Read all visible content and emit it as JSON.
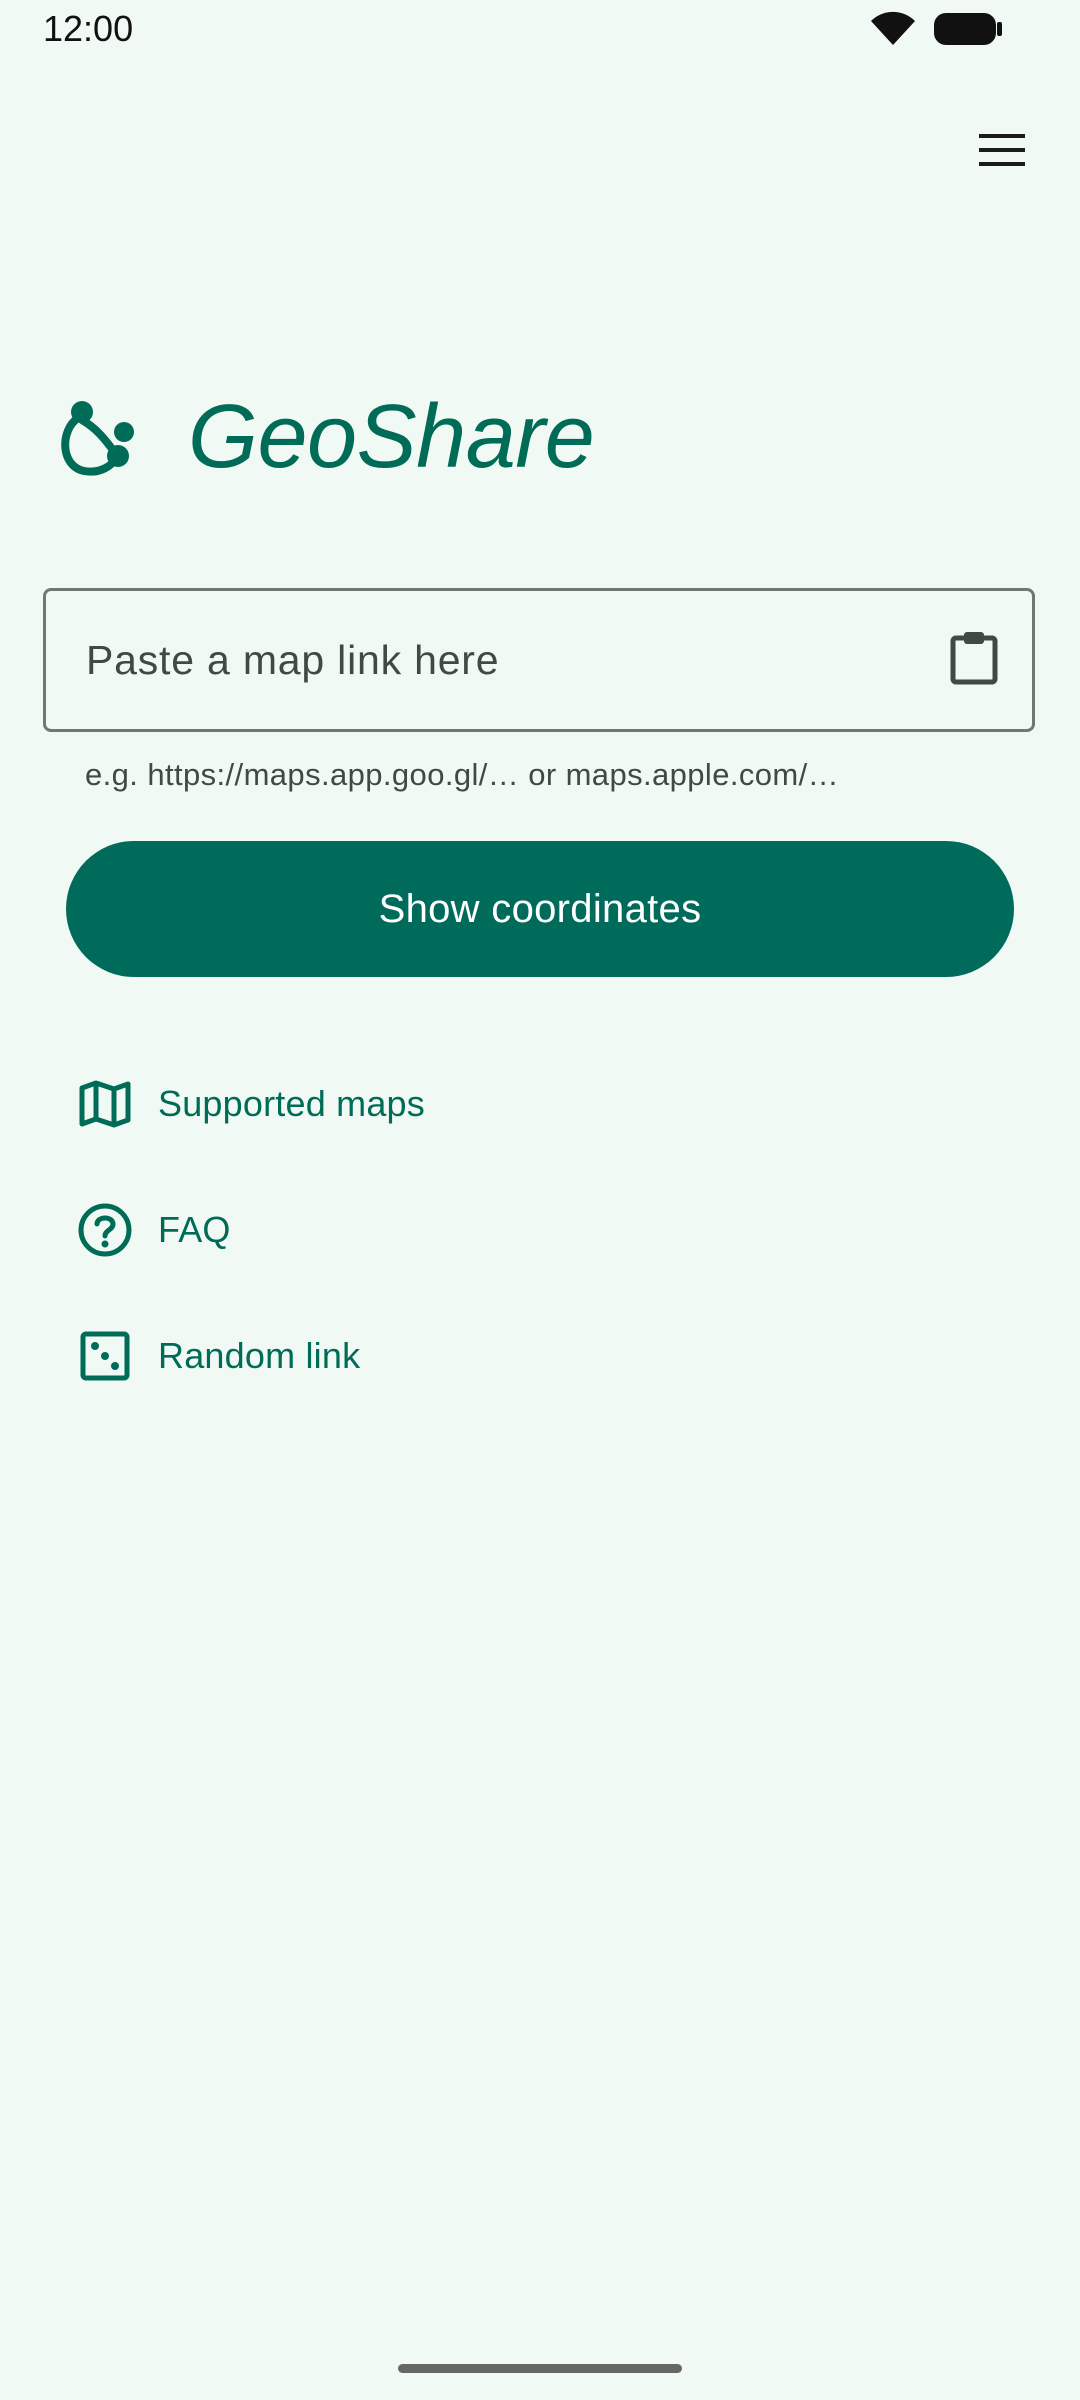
{
  "status_bar": {
    "time": "12:00",
    "icons": [
      "wifi-icon",
      "battery-icon"
    ]
  },
  "app": {
    "title": "GeoShare",
    "logo_icon": "geoshare-logo-icon",
    "accent_color": "#006B56",
    "background_color": "#F1F9F5"
  },
  "header": {
    "menu_icon": "hamburger-menu-icon"
  },
  "link_input": {
    "value": "",
    "placeholder": "Paste a map link here",
    "helper_text": "e.g. https://maps.app.goo.gl/… or maps.apple.com/…",
    "paste_icon": "clipboard-icon"
  },
  "primary_button": {
    "label": "Show coordinates",
    "color": "#006B5A"
  },
  "links": [
    {
      "label": "Supported maps",
      "icon": "map-icon"
    },
    {
      "label": "FAQ",
      "icon": "help-circle-icon"
    },
    {
      "label": "Random link",
      "icon": "dice-icon"
    }
  ]
}
